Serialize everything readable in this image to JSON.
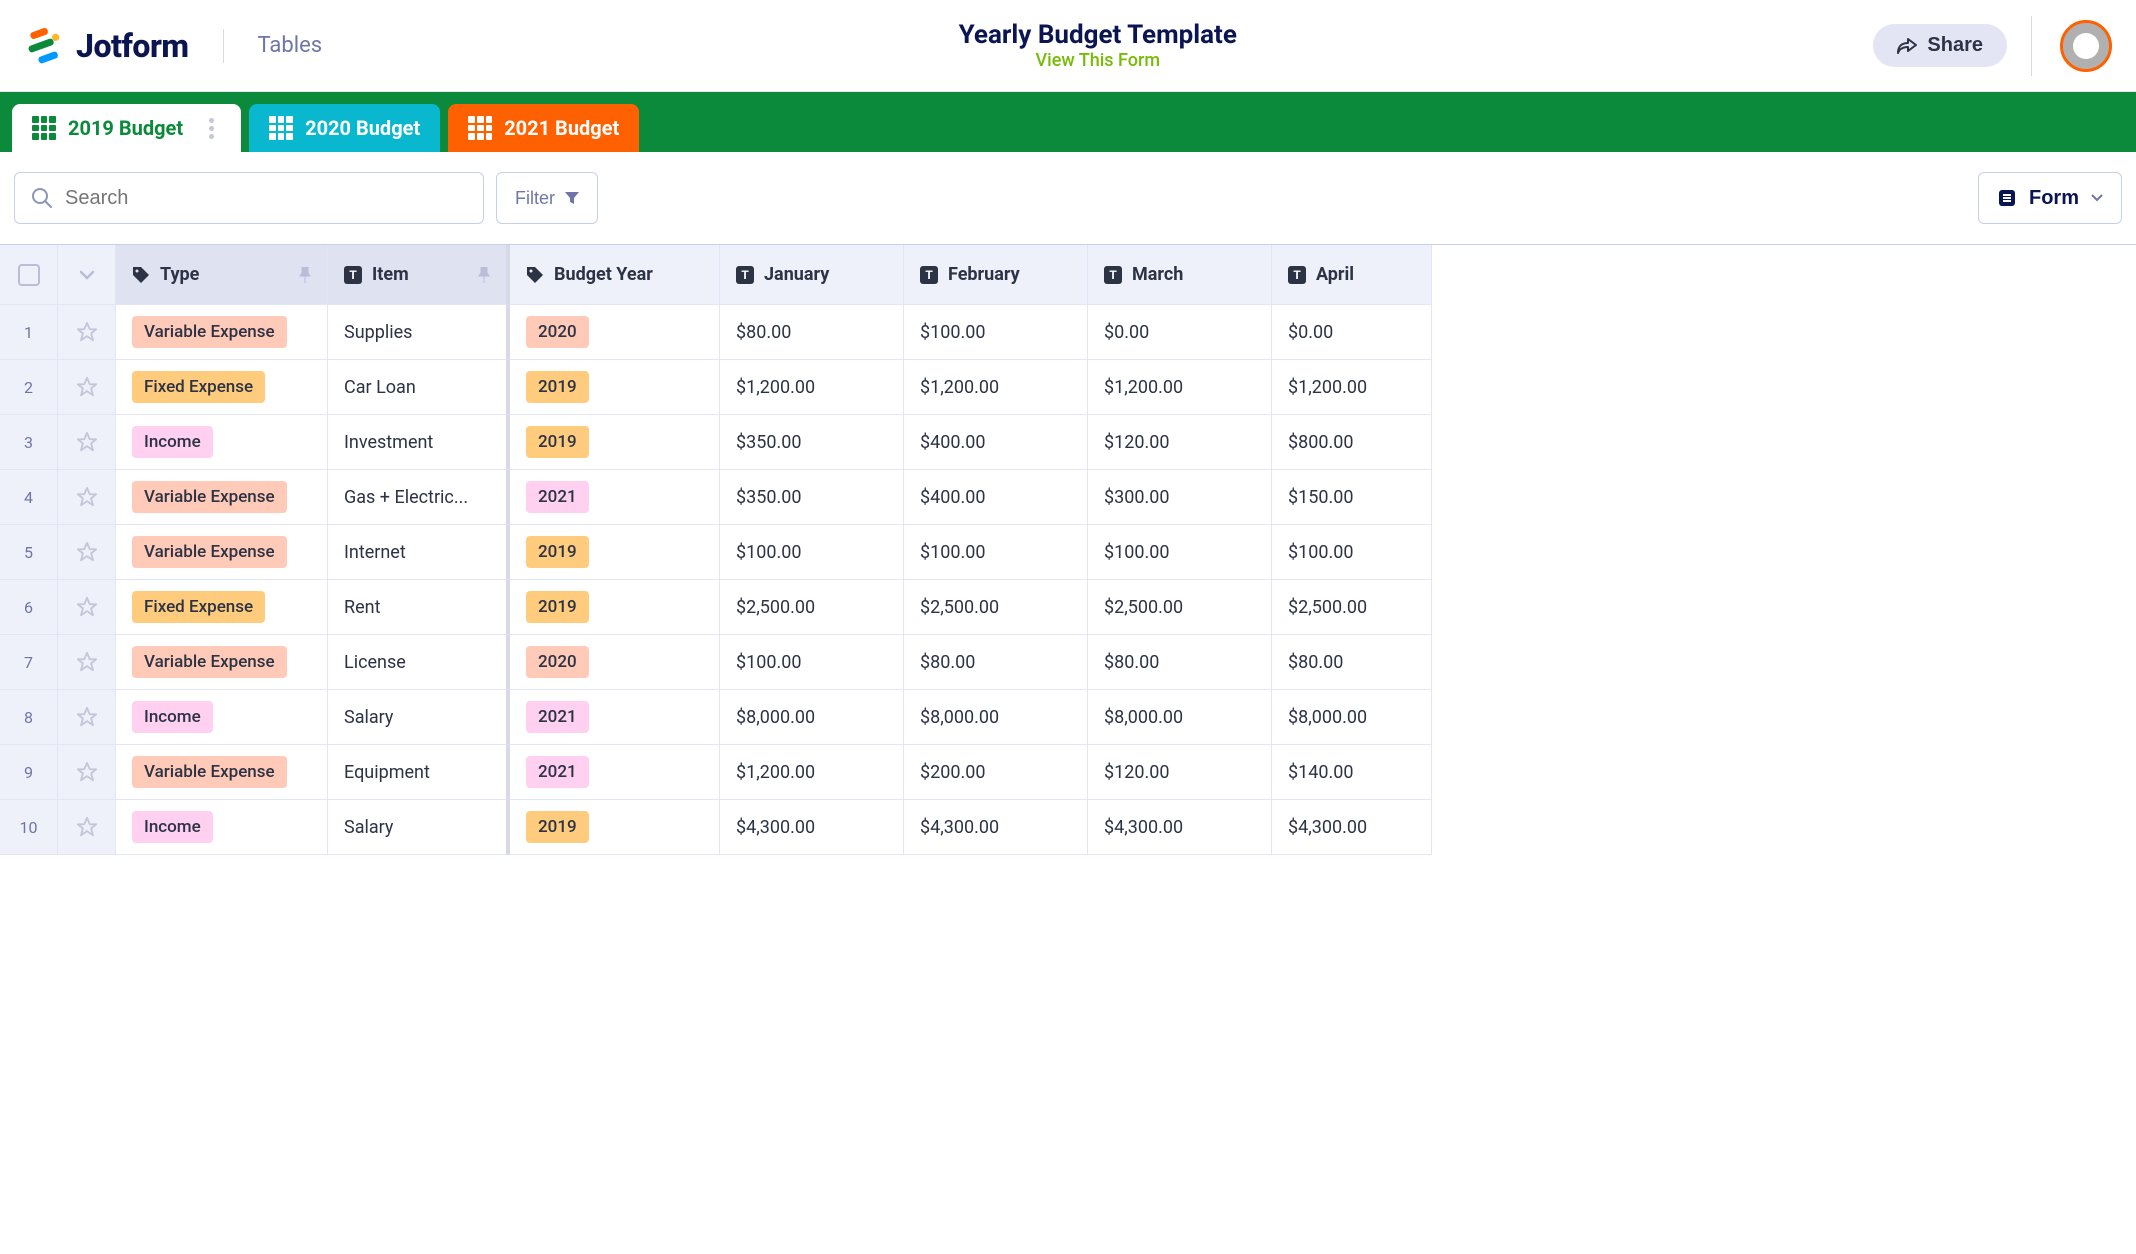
{
  "header": {
    "brand": "Jotform",
    "section": "Tables",
    "title": "Yearly Budget Template",
    "view_link": "View This Form",
    "share_label": "Share"
  },
  "tabs": [
    {
      "label": "2019 Budget",
      "style": "active"
    },
    {
      "label": "2020 Budget",
      "style": "teal"
    },
    {
      "label": "2021 Budget",
      "style": "orange"
    }
  ],
  "toolbar": {
    "search_placeholder": "Search",
    "filter_label": "Filter",
    "form_view_label": "Form"
  },
  "columns": [
    "Type",
    "Item",
    "Budget Year",
    "January",
    "February",
    "March",
    "April"
  ],
  "type_styles": {
    "Variable Expense": "tag-variable",
    "Fixed Expense": "tag-fixed",
    "Income": "tag-income"
  },
  "year_styles": {
    "2019": "tag-2019",
    "2020": "tag-2020",
    "2021": "tag-2021"
  },
  "rows": [
    {
      "n": "1",
      "type": "Variable Expense",
      "item": "Supplies",
      "year": "2020",
      "jan": "$80.00",
      "feb": "$100.00",
      "mar": "$0.00",
      "apr": "$0.00"
    },
    {
      "n": "2",
      "type": "Fixed Expense",
      "item": "Car Loan",
      "year": "2019",
      "jan": "$1,200.00",
      "feb": "$1,200.00",
      "mar": "$1,200.00",
      "apr": "$1,200.00"
    },
    {
      "n": "3",
      "type": "Income",
      "item": "Investment",
      "year": "2019",
      "jan": "$350.00",
      "feb": "$400.00",
      "mar": "$120.00",
      "apr": "$800.00"
    },
    {
      "n": "4",
      "type": "Variable Expense",
      "item": "Gas + Electric...",
      "year": "2021",
      "jan": "$350.00",
      "feb": "$400.00",
      "mar": "$300.00",
      "apr": "$150.00"
    },
    {
      "n": "5",
      "type": "Variable Expense",
      "item": "Internet",
      "year": "2019",
      "jan": "$100.00",
      "feb": "$100.00",
      "mar": "$100.00",
      "apr": "$100.00"
    },
    {
      "n": "6",
      "type": "Fixed Expense",
      "item": "Rent",
      "year": "2019",
      "jan": "$2,500.00",
      "feb": "$2,500.00",
      "mar": "$2,500.00",
      "apr": "$2,500.00"
    },
    {
      "n": "7",
      "type": "Variable Expense",
      "item": "License",
      "year": "2020",
      "jan": "$100.00",
      "feb": "$80.00",
      "mar": "$80.00",
      "apr": "$80.00"
    },
    {
      "n": "8",
      "type": "Income",
      "item": "Salary",
      "year": "2021",
      "jan": "$8,000.00",
      "feb": "$8,000.00",
      "mar": "$8,000.00",
      "apr": "$8,000.00"
    },
    {
      "n": "9",
      "type": "Variable Expense",
      "item": "Equipment",
      "year": "2021",
      "jan": "$1,200.00",
      "feb": "$200.00",
      "mar": "$120.00",
      "apr": "$140.00"
    },
    {
      "n": "10",
      "type": "Income",
      "item": "Salary",
      "year": "2019",
      "jan": "$4,300.00",
      "feb": "$4,300.00",
      "mar": "$4,300.00",
      "apr": "$4,300.00"
    }
  ]
}
